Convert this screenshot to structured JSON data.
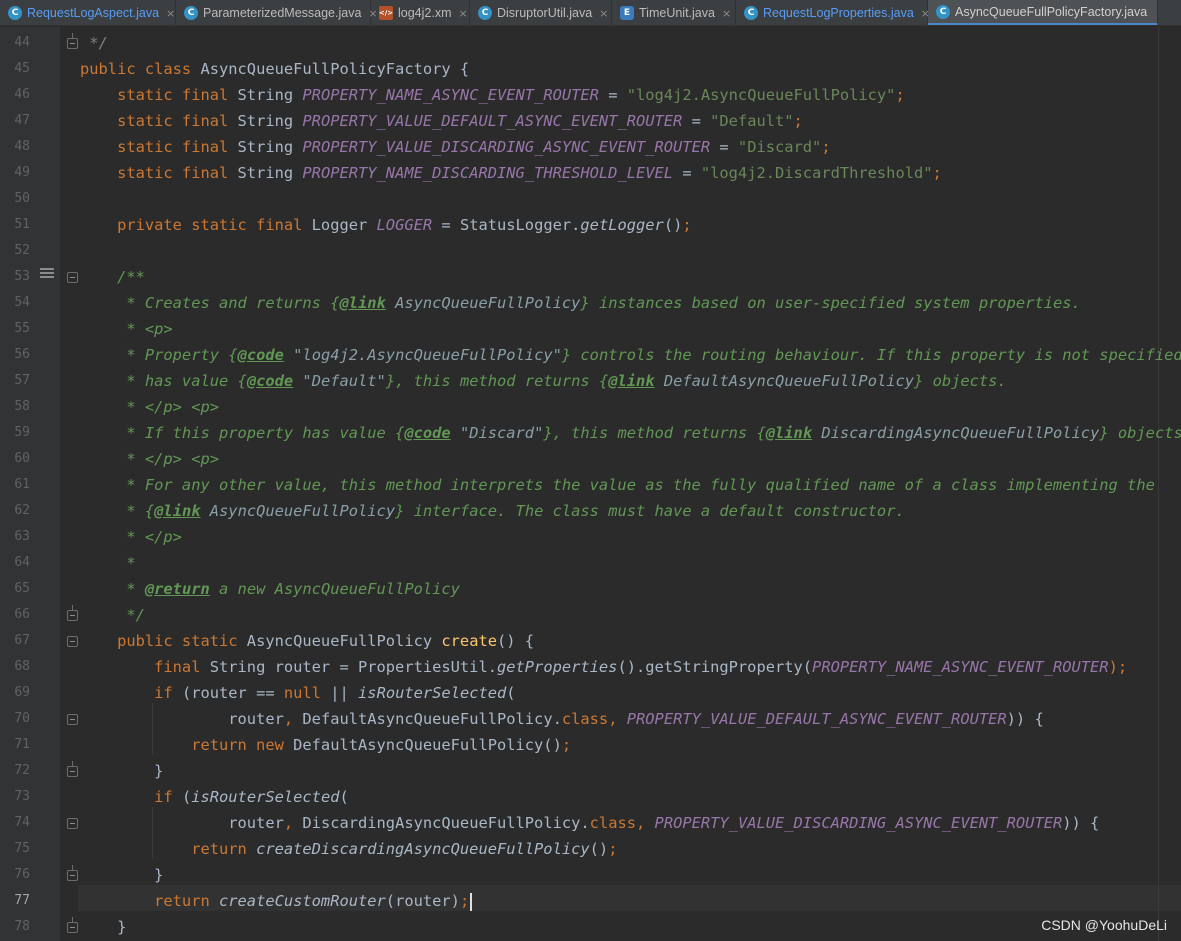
{
  "tabs": [
    {
      "label": "RequestLogAspect.java",
      "icon": "class-icon"
    },
    {
      "label": "ParameterizedMessage.java",
      "icon": "class-icon"
    },
    {
      "label": "log4j2.xm",
      "icon": "xml-icon"
    },
    {
      "label": "DisruptorUtil.java",
      "icon": "class-icon"
    },
    {
      "label": "TimeUnit.java",
      "icon": "enum-icon"
    },
    {
      "label": "RequestLogProperties.java",
      "icon": "class-icon"
    },
    {
      "label": "AsyncQueueFullPolicyFactory.java",
      "icon": "class-icon",
      "active": true
    }
  ],
  "tab_close_glyph": "×",
  "editor": {
    "current_line": "77",
    "line_numbers": [
      "44",
      "45",
      "46",
      "47",
      "48",
      "49",
      "50",
      "51",
      "52",
      "53",
      "54",
      "55",
      "56",
      "57",
      "58",
      "59",
      "60",
      "61",
      "62",
      "63",
      "64",
      "65",
      "66",
      "67",
      "68",
      "69",
      "70",
      "71",
      "72",
      "73",
      "74",
      "75",
      "76",
      "77",
      "78"
    ],
    "code": [
      [
        {
          "t": " */",
          "c": "cmm"
        }
      ],
      [
        {
          "t": "public class ",
          "c": "kw"
        },
        {
          "t": "AsyncQueueFullPolicyFactory {"
        }
      ],
      [
        {
          "t": "    static final ",
          "c": "kw"
        },
        {
          "t": "String "
        },
        {
          "t": "PROPERTY_NAME_ASYNC_EVENT_ROUTER",
          "c": "cst"
        },
        {
          "t": " = "
        },
        {
          "t": "\"log4j2.AsyncQueueFullPolicy\"",
          "c": "str"
        },
        {
          "t": ";",
          "c": "kw"
        }
      ],
      [
        {
          "t": "    static final ",
          "c": "kw"
        },
        {
          "t": "String "
        },
        {
          "t": "PROPERTY_VALUE_DEFAULT_ASYNC_EVENT_ROUTER",
          "c": "cst"
        },
        {
          "t": " = "
        },
        {
          "t": "\"Default\"",
          "c": "str"
        },
        {
          "t": ";",
          "c": "kw"
        }
      ],
      [
        {
          "t": "    static final ",
          "c": "kw"
        },
        {
          "t": "String "
        },
        {
          "t": "PROPERTY_VALUE_DISCARDING_ASYNC_EVENT_ROUTER",
          "c": "cst"
        },
        {
          "t": " = "
        },
        {
          "t": "\"Discard\"",
          "c": "str"
        },
        {
          "t": ";",
          "c": "kw"
        }
      ],
      [
        {
          "t": "    static final ",
          "c": "kw"
        },
        {
          "t": "String "
        },
        {
          "t": "PROPERTY_NAME_DISCARDING_THRESHOLD_LEVEL",
          "c": "cst"
        },
        {
          "t": " = "
        },
        {
          "t": "\"log4j2.DiscardThreshold\"",
          "c": "str"
        },
        {
          "t": ";",
          "c": "kw"
        }
      ],
      [],
      [
        {
          "t": "    private static final ",
          "c": "kw"
        },
        {
          "t": "Logger "
        },
        {
          "t": "LOGGER",
          "c": "cst"
        },
        {
          "t": " = StatusLogger."
        },
        {
          "t": "getLogger",
          "c": "it"
        },
        {
          "t": "()"
        },
        {
          "t": ";",
          "c": "kw"
        }
      ],
      [],
      [
        {
          "t": "    /**",
          "c": "cm"
        }
      ],
      [
        {
          "t": "     * Creates and returns ",
          "c": "cm"
        },
        {
          "t": "{",
          "c": "cm"
        },
        {
          "t": "@link",
          "c": "tag"
        },
        {
          "t": " AsyncQueueFullPolicy",
          "c": "ref"
        },
        {
          "t": "} instances based on user-specified system properties.",
          "c": "cm"
        }
      ],
      [
        {
          "t": "     * <p>",
          "c": "cm"
        }
      ],
      [
        {
          "t": "     * Property ",
          "c": "cm"
        },
        {
          "t": "{",
          "c": "cm"
        },
        {
          "t": "@code",
          "c": "tag"
        },
        {
          "t": " \"log4j2.AsyncQueueFullPolicy\"",
          "c": "ref"
        },
        {
          "t": "} controls the routing behaviour. If this property is not specified or",
          "c": "cm"
        }
      ],
      [
        {
          "t": "     * has value ",
          "c": "cm"
        },
        {
          "t": "{",
          "c": "cm"
        },
        {
          "t": "@code",
          "c": "tag"
        },
        {
          "t": " \"Default\"",
          "c": "ref"
        },
        {
          "t": "}, this method returns ",
          "c": "cm"
        },
        {
          "t": "{",
          "c": "cm"
        },
        {
          "t": "@link",
          "c": "tag"
        },
        {
          "t": " DefaultAsyncQueueFullPolicy",
          "c": "ref"
        },
        {
          "t": "} objects.",
          "c": "cm"
        }
      ],
      [
        {
          "t": "     * </p> <p>",
          "c": "cm"
        }
      ],
      [
        {
          "t": "     * If this property has value ",
          "c": "cm"
        },
        {
          "t": "{",
          "c": "cm"
        },
        {
          "t": "@code",
          "c": "tag"
        },
        {
          "t": " \"Discard\"",
          "c": "ref"
        },
        {
          "t": "}, this method returns ",
          "c": "cm"
        },
        {
          "t": "{",
          "c": "cm"
        },
        {
          "t": "@link",
          "c": "tag"
        },
        {
          "t": " DiscardingAsyncQueueFullPolicy",
          "c": "ref"
        },
        {
          "t": "} objects.",
          "c": "cm"
        }
      ],
      [
        {
          "t": "     * </p> <p>",
          "c": "cm"
        }
      ],
      [
        {
          "t": "     * For any other value, this method interprets the value as the fully qualified name of a class implementing the",
          "c": "cm"
        }
      ],
      [
        {
          "t": "     * ",
          "c": "cm"
        },
        {
          "t": "{",
          "c": "cm"
        },
        {
          "t": "@link",
          "c": "tag"
        },
        {
          "t": " AsyncQueueFullPolicy",
          "c": "ref"
        },
        {
          "t": "} interface. The class must have a default constructor.",
          "c": "cm"
        }
      ],
      [
        {
          "t": "     * </p>",
          "c": "cm"
        }
      ],
      [
        {
          "t": "     *",
          "c": "cm"
        }
      ],
      [
        {
          "t": "     * ",
          "c": "cm"
        },
        {
          "t": "@return",
          "c": "tag"
        },
        {
          "t": " a new AsyncQueueFullPolicy",
          "c": "cm"
        }
      ],
      [
        {
          "t": "     */",
          "c": "cm"
        }
      ],
      [
        {
          "t": "    public static ",
          "c": "kw"
        },
        {
          "t": "AsyncQueueFullPolicy "
        },
        {
          "t": "create",
          "c": "fn"
        },
        {
          "t": "() {"
        }
      ],
      [
        {
          "t": "        final ",
          "c": "kw"
        },
        {
          "t": "String router = PropertiesUtil."
        },
        {
          "t": "getProperties",
          "c": "it"
        },
        {
          "t": "().getStringProperty("
        },
        {
          "t": "PROPERTY_NAME_ASYNC_EVENT_ROUTER",
          "c": "cst"
        },
        {
          "t": ");",
          "c": "kw"
        }
      ],
      [
        {
          "t": "        if ",
          "c": "kw"
        },
        {
          "t": "(router == "
        },
        {
          "t": "null",
          "c": "kw"
        },
        {
          "t": " || "
        },
        {
          "t": "isRouterSelected",
          "c": "it"
        },
        {
          "t": "("
        }
      ],
      [
        {
          "t": "                router"
        },
        {
          "t": ", ",
          "c": "kw"
        },
        {
          "t": "DefaultAsyncQueueFullPolicy."
        },
        {
          "t": "class",
          "c": "kw"
        },
        {
          "t": ", ",
          "c": "kw"
        },
        {
          "t": "PROPERTY_VALUE_DEFAULT_ASYNC_EVENT_ROUTER",
          "c": "cst"
        },
        {
          "t": ")) {"
        }
      ],
      [
        {
          "t": "            return new ",
          "c": "kw"
        },
        {
          "t": "DefaultAsyncQueueFullPolicy()"
        },
        {
          "t": ";",
          "c": "kw"
        }
      ],
      [
        {
          "t": "        }"
        }
      ],
      [
        {
          "t": "        if ",
          "c": "kw"
        },
        {
          "t": "("
        },
        {
          "t": "isRouterSelected",
          "c": "it"
        },
        {
          "t": "("
        }
      ],
      [
        {
          "t": "                router"
        },
        {
          "t": ", ",
          "c": "kw"
        },
        {
          "t": "DiscardingAsyncQueueFullPolicy."
        },
        {
          "t": "class",
          "c": "kw"
        },
        {
          "t": ", ",
          "c": "kw"
        },
        {
          "t": "PROPERTY_VALUE_DISCARDING_ASYNC_EVENT_ROUTER",
          "c": "cst"
        },
        {
          "t": ")) {"
        }
      ],
      [
        {
          "t": "            return ",
          "c": "kw"
        },
        {
          "t": "createDiscardingAsyncQueueFullPolicy",
          "c": "it"
        },
        {
          "t": "()"
        },
        {
          "t": ";",
          "c": "kw"
        }
      ],
      [
        {
          "t": "        }"
        }
      ],
      [
        {
          "t": "        return ",
          "c": "kw"
        },
        {
          "t": "createCustomRouter",
          "c": "it"
        },
        {
          "t": "(router)"
        },
        {
          "t": ";",
          "c": "kw"
        }
      ],
      [
        {
          "t": "    }"
        }
      ]
    ]
  },
  "watermark": "CSDN @YoohuDeLi"
}
